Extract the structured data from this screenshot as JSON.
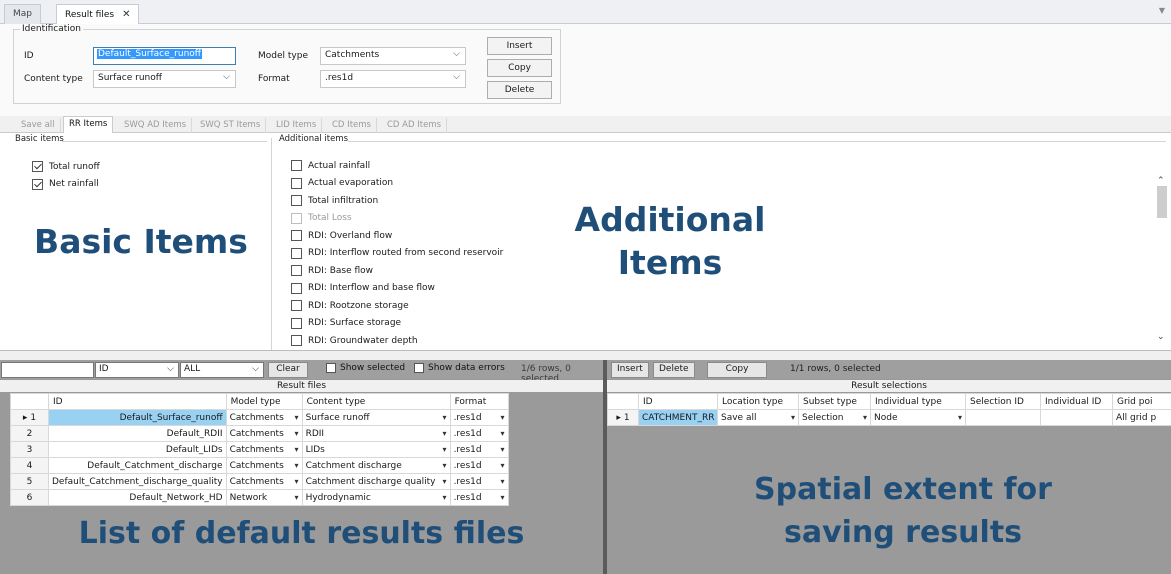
{
  "doc_tabs": {
    "map": "Map",
    "result_files": "Result files",
    "close": "✕"
  },
  "identification": {
    "title": "Identification",
    "id_label": "ID",
    "id_value": "Default_Surface_runoff",
    "content_type_label": "Content type",
    "content_type_value": "Surface runoff",
    "model_type_label": "Model type",
    "model_type_value": "Catchments",
    "format_label": "Format",
    "format_value": ".res1d",
    "insert": "Insert",
    "copy": "Copy",
    "delete": "Delete"
  },
  "item_tabs": [
    "Save all",
    "RR Items",
    "SWQ AD Items",
    "SWQ ST Items",
    "LID Items",
    "CD Items",
    "CD AD Items"
  ],
  "basic_items": {
    "header": "Basic items",
    "items": [
      {
        "label": "Total runoff",
        "checked": true
      },
      {
        "label": "Net rainfall",
        "checked": true
      }
    ]
  },
  "additional_items": {
    "header": "Additional items",
    "items": [
      "Actual rainfall",
      "Actual evaporation",
      "Total infiltration",
      "Total Loss",
      "RDI: Overland flow",
      "RDI: Interflow routed from second reservoir",
      "RDI: Base flow",
      "RDI: Interflow and base flow",
      "RDI: Rootzone storage",
      "RDI: Surface storage",
      "RDI: Groundwater depth"
    ]
  },
  "overlays": {
    "basic": "Basic Items",
    "additional_1": "Additional",
    "additional_2": "Items",
    "list": "List of default results files",
    "spatial_1": "Spatial extent for",
    "spatial_2": "saving results"
  },
  "result_files_panel": {
    "field_select": "ID",
    "filter_select": "ALL",
    "clear": "Clear",
    "show_selected": "Show selected",
    "show_data_errors": "Show data errors",
    "status": "1/6 rows, 0 selected",
    "title": "Result files",
    "columns": [
      "ID",
      "Model type",
      "Content type",
      "Format"
    ],
    "rows": [
      {
        "num": "1",
        "id": "Default_Surface_runoff",
        "model": "Catchments",
        "content": "Surface runoff",
        "format": ".res1d"
      },
      {
        "num": "2",
        "id": "Default_RDII",
        "model": "Catchments",
        "content": "RDII",
        "format": ".res1d"
      },
      {
        "num": "3",
        "id": "Default_LIDs",
        "model": "Catchments",
        "content": "LIDs",
        "format": ".res1d"
      },
      {
        "num": "4",
        "id": "Default_Catchment_discharge",
        "model": "Catchments",
        "content": "Catchment discharge",
        "format": ".res1d"
      },
      {
        "num": "5",
        "id": "Default_Catchment_discharge_quality",
        "model": "Catchments",
        "content": "Catchment discharge quality",
        "format": ".res1d"
      },
      {
        "num": "6",
        "id": "Default_Network_HD",
        "model": "Network",
        "content": "Hydrodynamic",
        "format": ".res1d"
      }
    ]
  },
  "result_selections_panel": {
    "insert": "Insert",
    "delete": "Delete",
    "copy": "Copy",
    "status": "1/1 rows, 0 selected",
    "title": "Result selections",
    "columns": [
      "ID",
      "Location type",
      "Subset type",
      "Individual type",
      "Selection ID",
      "Individual ID",
      "Grid poi"
    ],
    "rows": [
      {
        "num": "1",
        "id": "CATCHMENT_RR",
        "location": "Save all",
        "subset": "Selection",
        "individual_type": "Node",
        "selection_id": "",
        "individual_id": "",
        "grid": "All grid p"
      }
    ]
  }
}
